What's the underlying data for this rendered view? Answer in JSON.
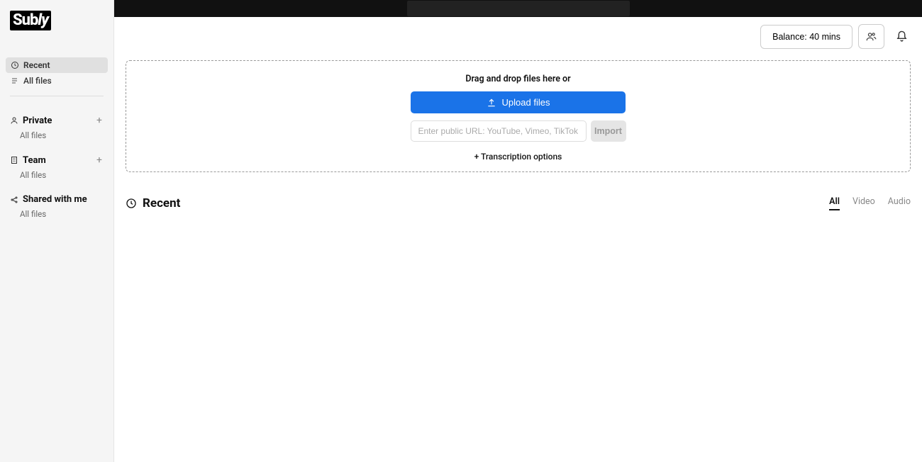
{
  "logo": {
    "text_left": "Sub",
    "text_right": "ly"
  },
  "sidebar": {
    "nav": [
      {
        "label": "Recent",
        "active": true
      },
      {
        "label": "All files",
        "active": false
      }
    ],
    "sections": [
      {
        "name": "private",
        "title": "Private",
        "sub": "All files",
        "has_add": true
      },
      {
        "name": "team",
        "title": "Team",
        "sub": "All files",
        "has_add": true
      },
      {
        "name": "shared",
        "title": "Shared with me",
        "sub": "All files",
        "has_add": false
      }
    ]
  },
  "header": {
    "balance": "Balance: 40 mins"
  },
  "dropzone": {
    "hint": "Drag and drop files here or",
    "upload_label": "Upload files",
    "url_placeholder": "Enter public URL: YouTube, Vimeo, TikTok...",
    "import_label": "Import",
    "options_label": "+ Transcription options"
  },
  "recent": {
    "title": "Recent",
    "tabs": [
      {
        "label": "All",
        "active": true
      },
      {
        "label": "Video",
        "active": false
      },
      {
        "label": "Audio",
        "active": false
      }
    ]
  }
}
